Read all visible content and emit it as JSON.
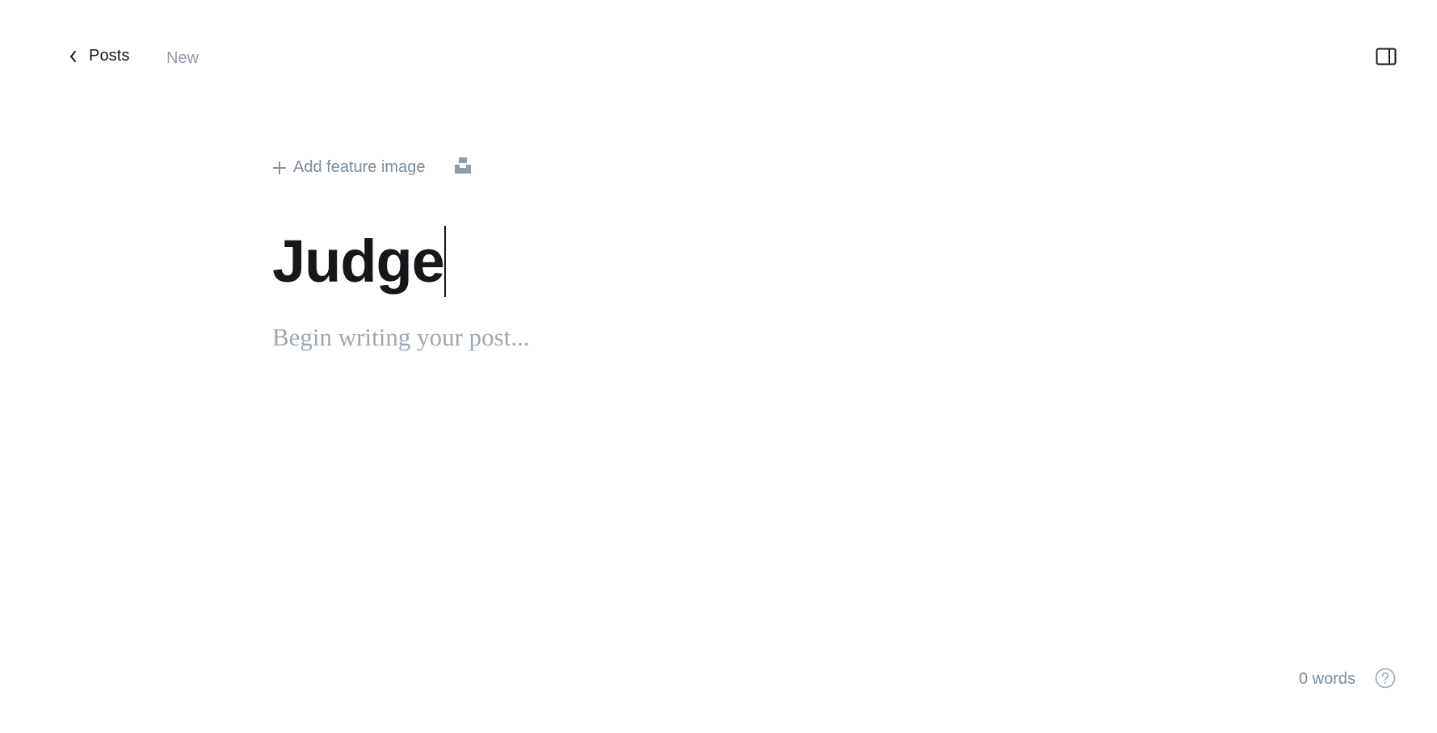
{
  "header": {
    "back_label": "Posts",
    "status": "New",
    "icons": {
      "back": "chevron-left-icon",
      "sidebar": "sidebar-panel-icon"
    }
  },
  "editor": {
    "feature_image_label": "Add feature image",
    "title_value": "Judge",
    "body_placeholder": "Begin writing your post..."
  },
  "footer": {
    "word_count": "0 words"
  },
  "colors": {
    "text_primary": "#15171a",
    "text_muted": "#8e9cac",
    "placeholder": "#9aa7b4",
    "background": "#ffffff"
  }
}
